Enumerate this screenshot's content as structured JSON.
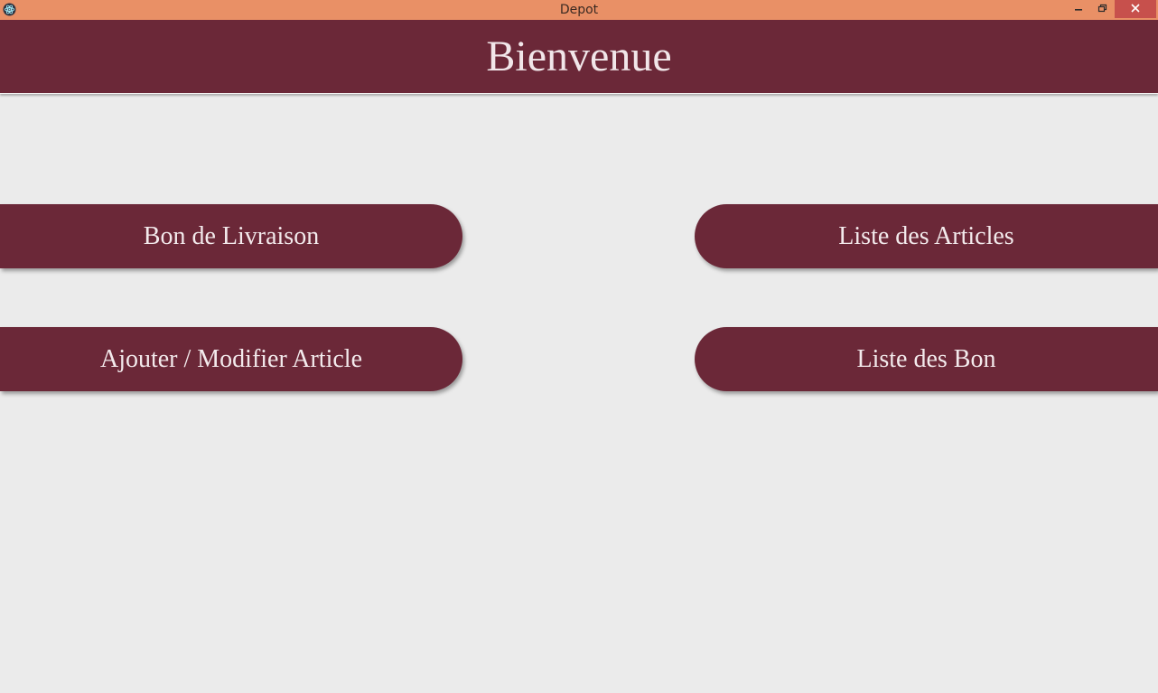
{
  "window": {
    "title": "Depot",
    "app_icon": "electron-icon",
    "controls": {
      "minimize_icon": "minimize-icon",
      "maximize_icon": "restore-icon",
      "close_icon": "close-icon"
    },
    "titlebar_color": "#e99066",
    "close_color": "#c7504c"
  },
  "header": {
    "title": "Bienvenue",
    "color": "#6b2838"
  },
  "menu": {
    "bon_livraison": "Bon de Livraison",
    "liste_articles": "Liste des Articles",
    "ajouter_modifier": "Ajouter / Modifier Article",
    "liste_bon": "Liste des Bon"
  },
  "colors": {
    "background": "#ebebeb",
    "accent": "#6b2838",
    "button_text": "#f3eaec"
  }
}
